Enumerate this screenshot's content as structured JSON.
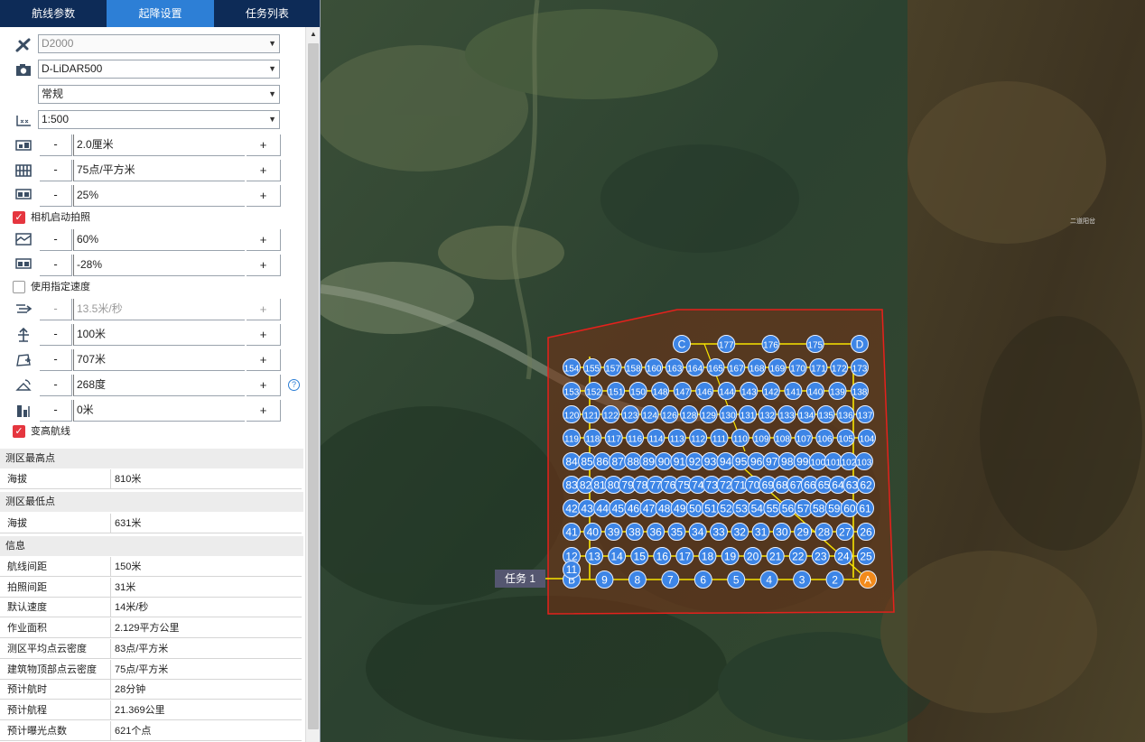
{
  "tabs": [
    {
      "label": "航线参数",
      "active": false
    },
    {
      "label": "起降设置",
      "active": true
    },
    {
      "label": "任务列表",
      "active": false
    }
  ],
  "drone": {
    "value": "D2000",
    "icon": "drone-icon"
  },
  "camera": {
    "value": "D-LiDAR500",
    "icon": "camera-icon"
  },
  "mode": {
    "value": "常规"
  },
  "scale": {
    "value": "1:500",
    "icon": "ruler-icon"
  },
  "params": {
    "gsd": {
      "value": "2.0厘米",
      "icon": "gsd-icon"
    },
    "density": {
      "value": "75点/平方米",
      "icon": "density-icon"
    },
    "overlap_side": {
      "value": "25%",
      "icon": "side-overlap-icon"
    },
    "overlap_front": {
      "value": "60%",
      "icon": "front-overlap-icon"
    },
    "overlap_other": {
      "value": "-28%",
      "icon": "overlap-icon"
    },
    "speed": {
      "value": "13.5米/秒",
      "icon": "speed-icon"
    },
    "altitude": {
      "value": "100米",
      "icon": "altitude-icon"
    },
    "extend": {
      "value": "707米",
      "icon": "extend-icon"
    },
    "heading": {
      "value": "268度",
      "icon": "heading-icon"
    },
    "offset": {
      "value": "0米",
      "icon": "offset-icon"
    }
  },
  "minus_label": "-",
  "plus_label": "+",
  "help_label": "?",
  "checks": {
    "camera_trigger": {
      "label": "相机启动拍照",
      "checked": true
    },
    "custom_speed": {
      "label": "使用指定速度",
      "checked": false
    },
    "terrain_follow": {
      "label": "变高航线",
      "checked": true
    }
  },
  "high_point": {
    "title": "测区最高点",
    "key": "海拔",
    "value": "810米"
  },
  "low_point": {
    "title": "测区最低点",
    "key": "海拔",
    "value": "631米"
  },
  "info": {
    "title": "信息",
    "rows": [
      {
        "k": "航线间距",
        "v": "150米"
      },
      {
        "k": "拍照间距",
        "v": "31米"
      },
      {
        "k": "默认速度",
        "v": "14米/秒"
      },
      {
        "k": "作业面积",
        "v": "2.129平方公里"
      },
      {
        "k": "测区平均点云密度",
        "v": "83点/平方米"
      },
      {
        "k": "建筑物顶部点云密度",
        "v": "75点/平方米"
      },
      {
        "k": "预计航时",
        "v": "28分钟"
      },
      {
        "k": "预计航程",
        "v": "21.369公里"
      },
      {
        "k": "预计曝光点数",
        "v": "621个点"
      }
    ]
  },
  "map": {
    "task_label": "任务 1",
    "place_label": "二道阳岔",
    "colors": {
      "boundary": "#e5211c",
      "route": "#f7e400",
      "waypoint": "#3d85e6",
      "start": "#f28a1b"
    },
    "waypoint_rows": [
      [
        {
          "t": "C"
        },
        {
          "t": "177"
        },
        {
          "t": "176"
        },
        {
          "t": "175"
        },
        {
          "t": "D"
        }
      ],
      [
        {
          "t": "154"
        },
        {
          "t": "155"
        },
        {
          "t": "157"
        },
        {
          "t": "158"
        },
        {
          "t": "160"
        },
        {
          "t": "163"
        },
        {
          "t": "164"
        },
        {
          "t": "165"
        },
        {
          "t": "167"
        },
        {
          "t": "168"
        },
        {
          "t": "169"
        },
        {
          "t": "170"
        },
        {
          "t": "171"
        },
        {
          "t": "172"
        },
        {
          "t": "173"
        }
      ],
      [
        {
          "t": "153"
        },
        {
          "t": "152"
        },
        {
          "t": "151"
        },
        {
          "t": "150"
        },
        {
          "t": "148"
        },
        {
          "t": "147"
        },
        {
          "t": "146"
        },
        {
          "t": "144"
        },
        {
          "t": "143"
        },
        {
          "t": "142"
        },
        {
          "t": "141"
        },
        {
          "t": "140"
        },
        {
          "t": "139"
        },
        {
          "t": "138"
        }
      ],
      [
        {
          "t": "120"
        },
        {
          "t": "121"
        },
        {
          "t": "122"
        },
        {
          "t": "123"
        },
        {
          "t": "124"
        },
        {
          "t": "126"
        },
        {
          "t": "128"
        },
        {
          "t": "129"
        },
        {
          "t": "130"
        },
        {
          "t": "131"
        },
        {
          "t": "132"
        },
        {
          "t": "133"
        },
        {
          "t": "134"
        },
        {
          "t": "135"
        },
        {
          "t": "136"
        },
        {
          "t": "137"
        }
      ],
      [
        {
          "t": "119"
        },
        {
          "t": "118"
        },
        {
          "t": "117"
        },
        {
          "t": "116"
        },
        {
          "t": "114"
        },
        {
          "t": "113"
        },
        {
          "t": "112"
        },
        {
          "t": "111"
        },
        {
          "t": "110"
        },
        {
          "t": "109"
        },
        {
          "t": "108"
        },
        {
          "t": "107"
        },
        {
          "t": "106"
        },
        {
          "t": "105"
        },
        {
          "t": "104"
        }
      ],
      [
        {
          "t": "84"
        },
        {
          "t": "85"
        },
        {
          "t": "86"
        },
        {
          "t": "87"
        },
        {
          "t": "88"
        },
        {
          "t": "89"
        },
        {
          "t": "90"
        },
        {
          "t": "91"
        },
        {
          "t": "92"
        },
        {
          "t": "93"
        },
        {
          "t": "94"
        },
        {
          "t": "95"
        },
        {
          "t": "96"
        },
        {
          "t": "97"
        },
        {
          "t": "98"
        },
        {
          "t": "99"
        },
        {
          "t": "100"
        },
        {
          "t": "101"
        },
        {
          "t": "102"
        },
        {
          "t": "103"
        }
      ],
      [
        {
          "t": "83"
        },
        {
          "t": "82"
        },
        {
          "t": "81"
        },
        {
          "t": "80"
        },
        {
          "t": "79"
        },
        {
          "t": "78"
        },
        {
          "t": "77"
        },
        {
          "t": "76"
        },
        {
          "t": "75"
        },
        {
          "t": "74"
        },
        {
          "t": "73"
        },
        {
          "t": "72"
        },
        {
          "t": "71"
        },
        {
          "t": "70"
        },
        {
          "t": "69"
        },
        {
          "t": "68"
        },
        {
          "t": "67"
        },
        {
          "t": "66"
        },
        {
          "t": "65"
        },
        {
          "t": "64"
        },
        {
          "t": "63"
        },
        {
          "t": "62"
        }
      ],
      [
        {
          "t": "42"
        },
        {
          "t": "43"
        },
        {
          "t": "44"
        },
        {
          "t": "45"
        },
        {
          "t": "46"
        },
        {
          "t": "47"
        },
        {
          "t": "48"
        },
        {
          "t": "49"
        },
        {
          "t": "50"
        },
        {
          "t": "51"
        },
        {
          "t": "52"
        },
        {
          "t": "53"
        },
        {
          "t": "54"
        },
        {
          "t": "55"
        },
        {
          "t": "56"
        },
        {
          "t": "57"
        },
        {
          "t": "58"
        },
        {
          "t": "59"
        },
        {
          "t": "60"
        },
        {
          "t": "61"
        }
      ],
      [
        {
          "t": "41"
        },
        {
          "t": "40"
        },
        {
          "t": "39"
        },
        {
          "t": "38"
        },
        {
          "t": "36"
        },
        {
          "t": "35"
        },
        {
          "t": "34"
        },
        {
          "t": "33"
        },
        {
          "t": "32"
        },
        {
          "t": "31"
        },
        {
          "t": "30"
        },
        {
          "t": "29"
        },
        {
          "t": "28"
        },
        {
          "t": "27"
        },
        {
          "t": "26"
        }
      ],
      [
        {
          "t": "12"
        },
        {
          "t": "13"
        },
        {
          "t": "14"
        },
        {
          "t": "15"
        },
        {
          "t": "16"
        },
        {
          "t": "17"
        },
        {
          "t": "18"
        },
        {
          "t": "19"
        },
        {
          "t": "20"
        },
        {
          "t": "21"
        },
        {
          "t": "22"
        },
        {
          "t": "23"
        },
        {
          "t": "24"
        },
        {
          "t": "25"
        }
      ],
      [
        {
          "t": "B"
        },
        {
          "t": "9"
        },
        {
          "t": "8"
        },
        {
          "t": "7"
        },
        {
          "t": "6"
        },
        {
          "t": "5"
        },
        {
          "t": "4"
        },
        {
          "t": "3"
        },
        {
          "t": "2"
        },
        {
          "t": "A"
        }
      ]
    ],
    "extra_waypoint": "11"
  }
}
